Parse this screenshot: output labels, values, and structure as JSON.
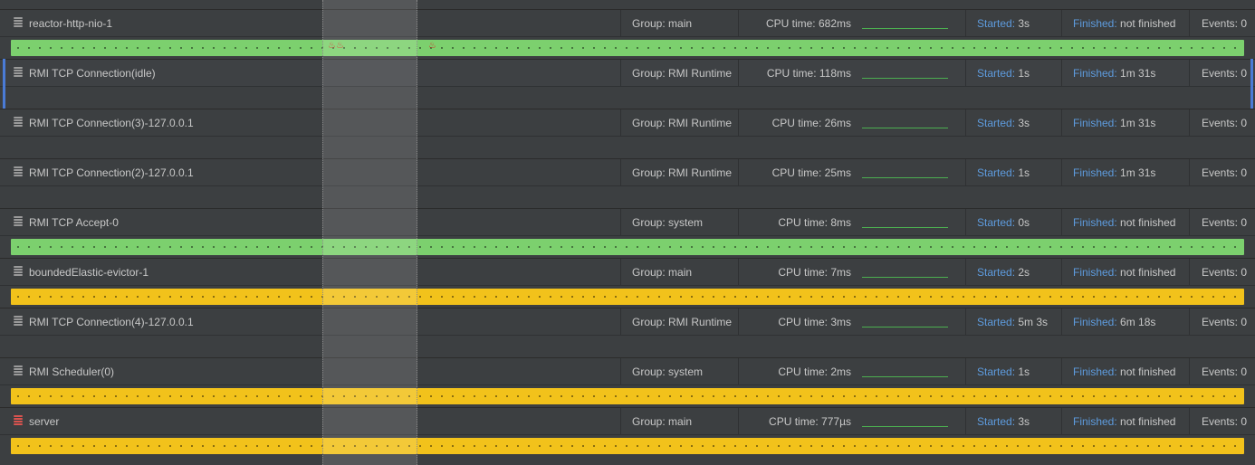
{
  "labels": {
    "group_prefix": "Group: ",
    "cpu_prefix": "CPU time: ",
    "started_label": "Started:",
    "finished_label": "Finished:",
    "events_prefix": "Events: "
  },
  "colors": {
    "running": "#7cd06e",
    "waiting": "#f2c21b",
    "link_blue": "#5e9cdf",
    "sparkline": "#4caf50",
    "marker_red": "#d33a2a"
  },
  "threads": [
    {
      "name": "reactor-http-nio-1",
      "group_text": "Group: main",
      "cpu_text": "CPU time: 682ms",
      "started": "3s",
      "finished": "not finished",
      "events_text": "Events: 0",
      "state": "running",
      "icon": "thread-stack-icon"
    },
    {
      "name": "RMI TCP Connection(idle)",
      "group_text": "Group: RMI Runtime",
      "cpu_text": "CPU time: 118ms",
      "started": "1s",
      "finished": "1m 31s",
      "events_text": "Events: 0",
      "state": "none",
      "icon": "thread-stack-icon",
      "selected": true
    },
    {
      "name": "RMI TCP Connection(3)-127.0.0.1",
      "group_text": "Group: RMI Runtime",
      "cpu_text": "CPU time: 26ms",
      "started": "3s",
      "finished": "1m 31s",
      "events_text": "Events: 0",
      "state": "none",
      "icon": "thread-stack-icon"
    },
    {
      "name": "RMI TCP Connection(2)-127.0.0.1",
      "group_text": "Group: RMI Runtime",
      "cpu_text": "CPU time: 25ms",
      "started": "1s",
      "finished": "1m 31s",
      "events_text": "Events: 0",
      "state": "none",
      "icon": "thread-stack-icon"
    },
    {
      "name": "RMI TCP Accept-0",
      "group_text": "Group: system",
      "cpu_text": "CPU time: 8ms",
      "started": "0s",
      "finished": "not finished",
      "events_text": "Events: 0",
      "state": "running",
      "icon": "thread-stack-icon"
    },
    {
      "name": "boundedElastic-evictor-1",
      "group_text": "Group: main",
      "cpu_text": "CPU time: 7ms",
      "started": "2s",
      "finished": "not finished",
      "events_text": "Events: 0",
      "state": "waiting",
      "icon": "thread-stack-icon"
    },
    {
      "name": "RMI TCP Connection(4)-127.0.0.1",
      "group_text": "Group: RMI Runtime",
      "cpu_text": "CPU time: 3ms",
      "started": "5m 3s",
      "finished": "6m 18s",
      "events_text": "Events: 0",
      "state": "none",
      "icon": "thread-stack-icon"
    },
    {
      "name": "RMI Scheduler(0)",
      "group_text": "Group: system",
      "cpu_text": "CPU time: 2ms",
      "started": "1s",
      "finished": "not finished",
      "events_text": "Events: 0",
      "state": "waiting",
      "icon": "thread-stack-icon"
    },
    {
      "name": "server",
      "group_text": "Group: main",
      "cpu_text": "CPU time: 777µs",
      "started": "3s",
      "finished": "not finished",
      "events_text": "Events: 0",
      "state": "waiting",
      "icon": "thread-stack-icon-red"
    }
  ],
  "markers": {
    "thread_index": 0,
    "icon": "flame-icon",
    "glyph": "♨",
    "count": 3
  }
}
